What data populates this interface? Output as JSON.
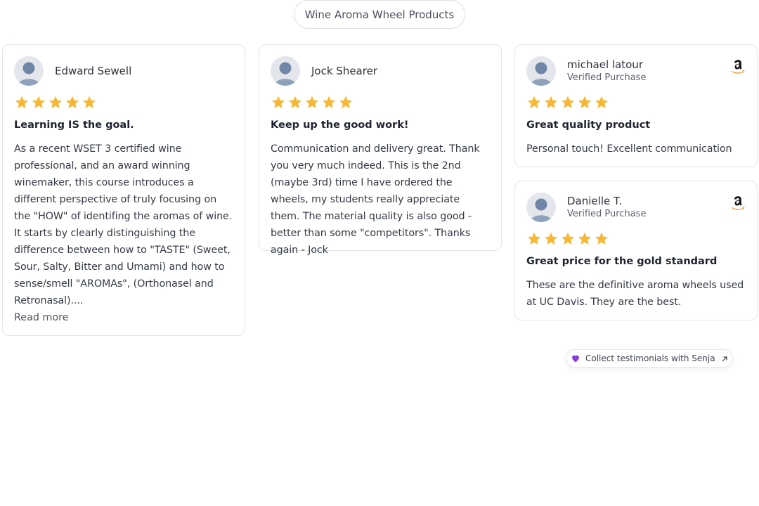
{
  "header": {
    "pill_label": "Wine Aroma Wheel Products"
  },
  "colors": {
    "star": "#f7b733",
    "amazon": "#1a1a1a",
    "amazon_smile": "#f08c00",
    "senja_heart": "#8b3fd9"
  },
  "reviews": [
    {
      "author": "Edward Sewell",
      "rating": 5,
      "title": "Learning IS the goal.",
      "body": "As a recent WSET 3 certified wine professional, and an award winning winemaker, this course introduces a different perspective of truly focusing on the \"HOW\" of identifing the aromas of wine. It starts by clearly distinguishing the difference between how to \"TASTE\" (Sweet, Sour, Salty, Bitter and Umami) and how to sense/smell \"AROMAs\", (Orthonasel and Retronasal)....",
      "read_more": "Read more"
    },
    {
      "author": "Jock Shearer",
      "rating": 5,
      "title": "Keep up the good work!",
      "body": "Communication and delivery great. Thank you very much indeed. This is the 2nd (maybe 3rd) time I have ordered the wheels, my students really appreciate them. The material quality is also good - better than some \"competitors\". Thanks again - Jock"
    },
    {
      "author": "michael latour",
      "verified": "Verified Purchase",
      "source_icon": "amazon-icon",
      "rating": 5,
      "title": "Great quality product",
      "body": "Personal touch! Excellent communication"
    },
    {
      "author": "Danielle T.",
      "verified": "Verified Purchase",
      "source_icon": "amazon-icon",
      "rating": 5,
      "title": "Great price for the gold standard",
      "body": "These are the definitive aroma wheels used at UC Davis. They are the best."
    }
  ],
  "footer": {
    "senja_label": "Collect testimonials with Senja"
  }
}
